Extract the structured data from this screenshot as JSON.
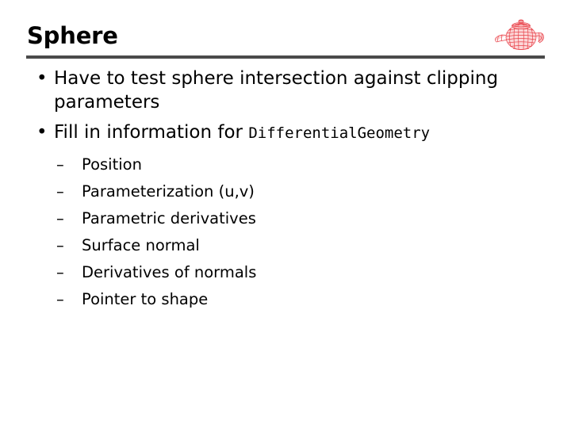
{
  "slide": {
    "title": "Sphere",
    "logo_icon": "teapot-wireframe-icon",
    "logo_color": "#e8424a",
    "rule_color": "#4a4a4a",
    "background_color": "#ffffff",
    "text_color": "#000000",
    "bullets": [
      {
        "marker": "•",
        "text": "Have to test sphere intersection against clipping parameters",
        "mono_suffix": ""
      },
      {
        "marker": "•",
        "text": "Fill in information for ",
        "mono_suffix": "DifferentialGeometry"
      }
    ],
    "sub_bullets": [
      {
        "marker": "–",
        "text": "Position"
      },
      {
        "marker": "–",
        "text": "Parameterization (u,v)"
      },
      {
        "marker": "–",
        "text": "Parametric derivatives"
      },
      {
        "marker": "–",
        "text": "Surface normal"
      },
      {
        "marker": "–",
        "text": "Derivatives of normals"
      },
      {
        "marker": "–",
        "text": "Pointer to shape"
      }
    ]
  }
}
